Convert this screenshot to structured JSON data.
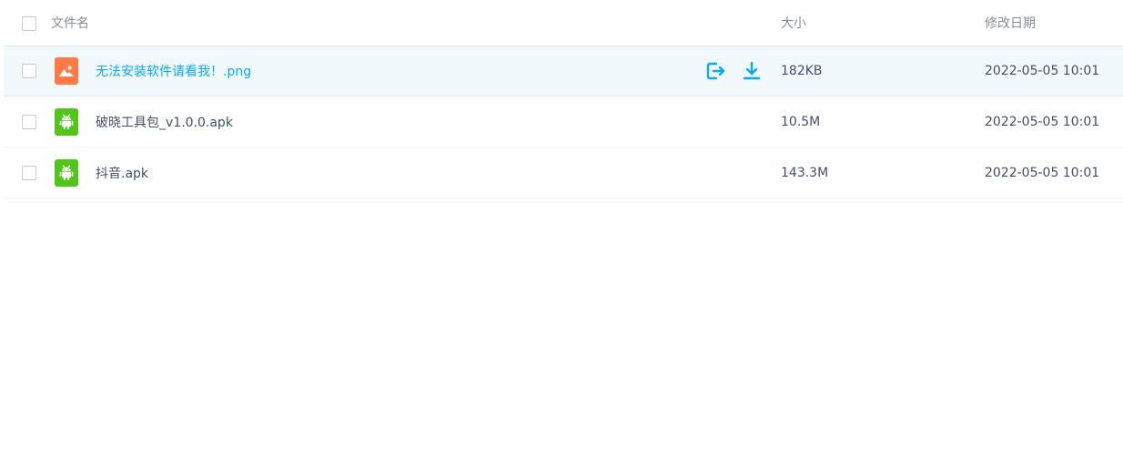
{
  "header": {
    "name_label": "文件名",
    "size_label": "大小",
    "date_label": "修改日期"
  },
  "files": [
    {
      "name": "无法安装软件请看我！.png",
      "size": "182KB",
      "modified": "2022-05-05 10:01",
      "icon": "image-file-icon",
      "icon_color": "#ff7a45",
      "hovered": true
    },
    {
      "name": "破晓工具包_v1.0.0.apk",
      "size": "10.5M",
      "modified": "2022-05-05 10:01",
      "icon": "android-apk-icon",
      "icon_color": "#52c41a",
      "hovered": false
    },
    {
      "name": "抖音.apk",
      "size": "143.3M",
      "modified": "2022-05-05 10:01",
      "icon": "android-apk-icon",
      "icon_color": "#52c41a",
      "hovered": false
    }
  ],
  "colors": {
    "accent": "#06a7ff",
    "text": "#424e67",
    "header_text": "#878c9c",
    "hover_bg": "#f2f9fc"
  }
}
